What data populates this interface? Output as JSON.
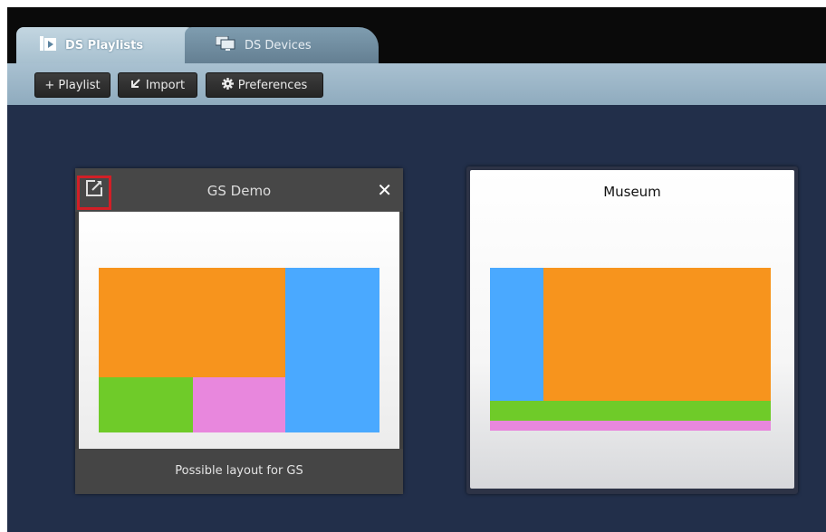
{
  "tabs": [
    {
      "label": "DS Playlists",
      "icon": "playlist-icon",
      "active": true
    },
    {
      "label": "DS Devices",
      "icon": "devices-icon",
      "active": false
    }
  ],
  "toolbar": {
    "add_playlist_label": "+ Playlist",
    "import_label": "Import",
    "preferences_label": "Preferences"
  },
  "playlists": [
    {
      "title": "GS Demo",
      "description": "Possible layout for GS",
      "close_glyph": "✕",
      "zones": [
        {
          "color": "#f7941d"
        },
        {
          "color": "#4aa9ff"
        },
        {
          "color": "#6fcb29"
        },
        {
          "color": "#e887dd"
        }
      ]
    },
    {
      "title": "Museum",
      "description": "",
      "zones": [
        {
          "color": "#4aa9ff"
        },
        {
          "color": "#f7941d"
        },
        {
          "color": "#6fcb29"
        },
        {
          "color": "#e887dd"
        }
      ]
    }
  ],
  "colors": {
    "background": "#222f4a",
    "accent_highlight": "#d21f26"
  }
}
